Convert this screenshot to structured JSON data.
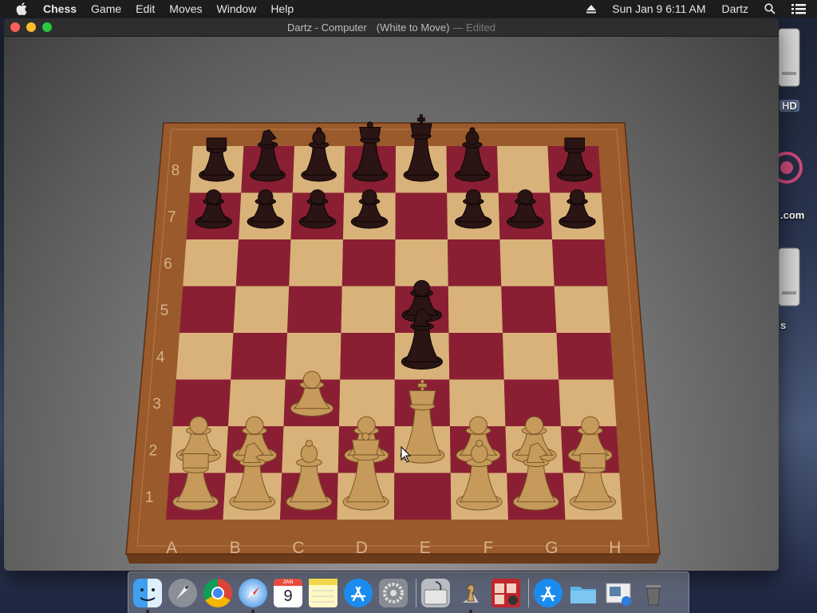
{
  "menubar": {
    "app_name": "Chess",
    "items": [
      "Game",
      "Edit",
      "Moves",
      "Window",
      "Help"
    ],
    "datetime": "Sun Jan 9  6:11 AM",
    "user": "Dartz"
  },
  "window": {
    "title": "Dartz - Computer",
    "status": "(White to Move)",
    "edited": "— Edited"
  },
  "desktop": {
    "labels": [
      "HD",
      ".com",
      "s"
    ]
  },
  "board": {
    "files": [
      "A",
      "B",
      "C",
      "D",
      "E",
      "F",
      "G",
      "H"
    ],
    "ranks": [
      "1",
      "2",
      "3",
      "4",
      "5",
      "6",
      "7",
      "8"
    ],
    "pieces": [
      {
        "sq": "a8",
        "color": "black",
        "type": "rook"
      },
      {
        "sq": "b8",
        "color": "black",
        "type": "knight"
      },
      {
        "sq": "c8",
        "color": "black",
        "type": "bishop"
      },
      {
        "sq": "d8",
        "color": "black",
        "type": "queen"
      },
      {
        "sq": "e8",
        "color": "black",
        "type": "king"
      },
      {
        "sq": "f8",
        "color": "black",
        "type": "bishop"
      },
      {
        "sq": "h8",
        "color": "black",
        "type": "rook"
      },
      {
        "sq": "a7",
        "color": "black",
        "type": "pawn"
      },
      {
        "sq": "b7",
        "color": "black",
        "type": "pawn"
      },
      {
        "sq": "c7",
        "color": "black",
        "type": "pawn"
      },
      {
        "sq": "d7",
        "color": "black",
        "type": "pawn"
      },
      {
        "sq": "f7",
        "color": "black",
        "type": "pawn"
      },
      {
        "sq": "g7",
        "color": "black",
        "type": "pawn"
      },
      {
        "sq": "h7",
        "color": "black",
        "type": "pawn"
      },
      {
        "sq": "e5",
        "color": "black",
        "type": "pawn"
      },
      {
        "sq": "e4",
        "color": "black",
        "type": "knight"
      },
      {
        "sq": "c3",
        "color": "white",
        "type": "pawn"
      },
      {
        "sq": "a2",
        "color": "white",
        "type": "pawn"
      },
      {
        "sq": "b2",
        "color": "white",
        "type": "pawn"
      },
      {
        "sq": "d2",
        "color": "white",
        "type": "pawn"
      },
      {
        "sq": "e2",
        "color": "white",
        "type": "king"
      },
      {
        "sq": "f2",
        "color": "white",
        "type": "pawn"
      },
      {
        "sq": "g2",
        "color": "white",
        "type": "pawn"
      },
      {
        "sq": "h2",
        "color": "white",
        "type": "pawn"
      },
      {
        "sq": "a1",
        "color": "white",
        "type": "rook"
      },
      {
        "sq": "b1",
        "color": "white",
        "type": "knight"
      },
      {
        "sq": "c1",
        "color": "white",
        "type": "bishop"
      },
      {
        "sq": "d1",
        "color": "white",
        "type": "queen"
      },
      {
        "sq": "f1",
        "color": "white",
        "type": "bishop"
      },
      {
        "sq": "g1",
        "color": "white",
        "type": "knight"
      },
      {
        "sq": "h1",
        "color": "white",
        "type": "rook"
      }
    ]
  },
  "colors": {
    "light_square": "#d9b27a",
    "dark_square": "#8a1f33",
    "frame": "#9a5a2c",
    "black_piece": "#2a1414",
    "white_piece": "#c59a5a"
  },
  "dock": {
    "calendar_month": "JAN",
    "calendar_day": "9",
    "apps": [
      "finder-icon",
      "launchpad-icon",
      "chrome-icon",
      "safari-icon",
      "calendar-icon",
      "notes-icon",
      "app-store-icon",
      "system-preferences-icon",
      "disk-utility-icon",
      "chess-icon",
      "photo-booth-icon",
      "app-store-icon",
      "folder-icon",
      "preview-icon",
      "trash-icon"
    ]
  }
}
